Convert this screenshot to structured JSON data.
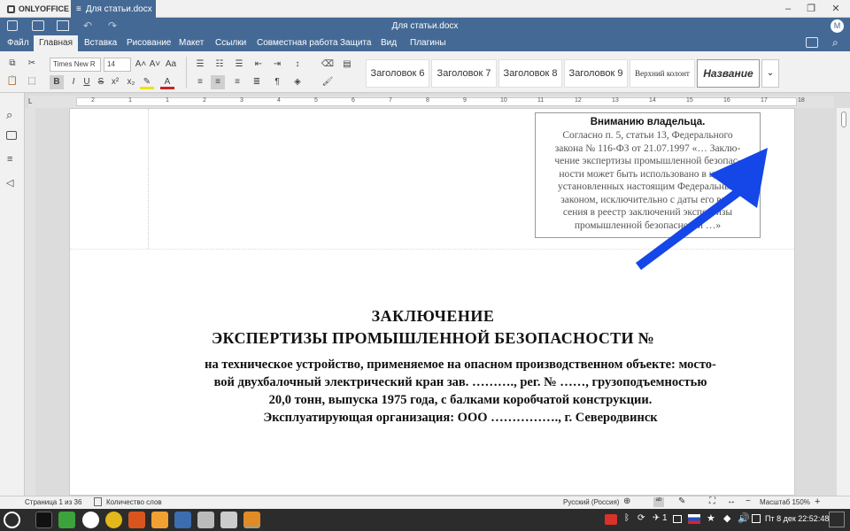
{
  "app": {
    "name": "ONLYOFFICE",
    "doc_tab": "Для статьи.docx",
    "title": "Для статьи.docx",
    "user_initial": "M"
  },
  "menu": [
    "Файл",
    "Главная",
    "Вставка",
    "Рисование",
    "Макет",
    "Ссылки",
    "Совместная работа",
    "Защита",
    "Вид",
    "Плагины"
  ],
  "toolbar": {
    "font": "Times New R",
    "size": "14",
    "bold": "B",
    "italic": "I",
    "underline": "U",
    "strike": "S",
    "sup": "x²",
    "sub": "x₂",
    "fontcolor": "A"
  },
  "styles": [
    "Заголовок 6",
    "Заголовок 7",
    "Заголовок 8",
    "Заголовок 9",
    "Верхний колонт",
    "Название"
  ],
  "ruler_numbers": [
    "2",
    "1",
    "1",
    "2",
    "3",
    "4",
    "5",
    "6",
    "7",
    "8",
    "9",
    "10",
    "11",
    "12",
    "13",
    "14",
    "15",
    "16",
    "17",
    "18"
  ],
  "header_box": {
    "title": "Вниманию владельца.",
    "lines": [
      "Согласно п. 5, статьи 13, Федерального",
      "закона № 116-ФЗ от 21.07.1997 «… Заклю-",
      "чение экспертизы промышленной безопас-",
      "ности может быть использовано в целях,",
      "установленных настоящим Федеральным",
      "законом, исключительно с даты его вне-",
      "сения в реестр заключений экспертизы",
      "промышленной безопасности …»"
    ]
  },
  "document": {
    "title1": "ЗАКЛЮЧЕНИЕ",
    "title2": "ЭКСПЕРТИЗЫ ПРОМЫШЛЕННОЙ БЕЗОПАСНОСТИ №",
    "body": [
      "на техническое устройство, применяемое на опасном производственном объекте: мосто-",
      "вой двухбалочный электрический кран зав. ………., рег. № ……, грузоподъемностью",
      "20,0  тонн, выпуска 1975 года, с балками коробчатой конструкции.",
      "Эксплуатирующая организация: ООО ……………., г. Северодвинск"
    ]
  },
  "status": {
    "page": "Страница 1 из 36",
    "wordcount": "Количество слов",
    "lang": "Русский (Россия)",
    "zoom": "Масштаб 150%"
  },
  "taskbar": {
    "time": "Пт   8 дек 22:52:48",
    "wifi_count": "1"
  },
  "colors": {
    "accent": "#446995",
    "arrow": "#1446e8"
  }
}
